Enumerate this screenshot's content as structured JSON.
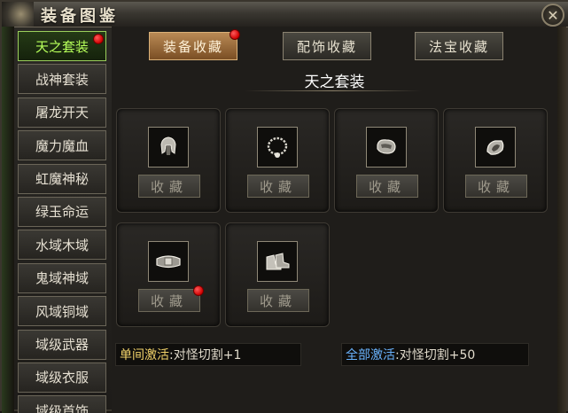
{
  "window": {
    "title": "装备图鉴",
    "close_glyph": "✕"
  },
  "sidebar": {
    "items": [
      {
        "label": "天之套装",
        "active": true,
        "badge": true
      },
      {
        "label": "战神套装"
      },
      {
        "label": "屠龙开天"
      },
      {
        "label": "魔力魔血"
      },
      {
        "label": "虹魔神秘"
      },
      {
        "label": "绿玉命运"
      },
      {
        "label": "水域木域"
      },
      {
        "label": "鬼域神域"
      },
      {
        "label": "风域铜域"
      },
      {
        "label": "域级武器"
      },
      {
        "label": "域级衣服"
      },
      {
        "label": "域级首饰"
      }
    ]
  },
  "tabs": [
    {
      "label": "装备收藏",
      "active": true,
      "badge": true
    },
    {
      "label": "配饰收藏"
    },
    {
      "label": "法宝收藏"
    }
  ],
  "section": {
    "title": "天之套装"
  },
  "items": [
    {
      "icon": "helmet-icon",
      "button": "收藏"
    },
    {
      "icon": "necklace-icon",
      "button": "收藏"
    },
    {
      "icon": "bracelet-icon",
      "button": "收藏"
    },
    {
      "icon": "ring-icon",
      "button": "收藏"
    },
    {
      "icon": "belt-icon",
      "button": "收藏",
      "badge": true
    },
    {
      "icon": "boots-icon",
      "button": "收藏"
    }
  ],
  "status": {
    "single": {
      "label": "单间激活",
      "value": ":对怪切割+1"
    },
    "all": {
      "label": "全部激活",
      "value": ":对怪切割+50"
    }
  },
  "colors": {
    "active_green": "#b6ff5a",
    "badge_red": "#d00000",
    "label_yellow": "#f2d36a",
    "label_blue": "#6ab4ff"
  }
}
